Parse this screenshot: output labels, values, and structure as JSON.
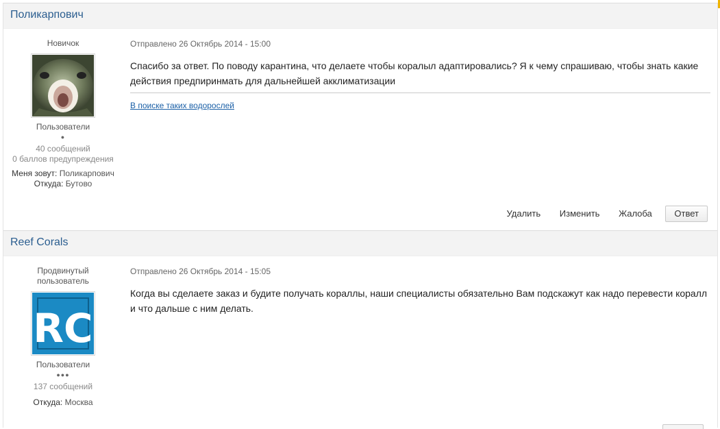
{
  "accent_color": "#2a5d8f",
  "posts": [
    {
      "author_name": "Поликарпович",
      "rank": "Новичок",
      "avatar": "fish-mouth-photo",
      "group": "Пользователи",
      "pips": "●",
      "posts_count": "40 сообщений",
      "warnings": "0 баллов предупреждения",
      "field1_key": "Меня зовут:",
      "field1_val": "Поликарпович",
      "field2_key": "Откуда:",
      "field2_val": "Бутово",
      "meta": "Отправлено 26 Октябрь 2014 - 15:00",
      "text": "Спасибо за ответ. По поводу карантина, что делаете чтобы коралыл адаптировались? Я к чему спрашиваю, чтобы знать какие действия предпиринмать для дальнейшей акклиматизации",
      "signature_link": "В поиске таких водорослей",
      "actions": {
        "delete": "Удалить",
        "edit": "Изменить",
        "report": "Жалоба",
        "reply": "Ответ"
      }
    },
    {
      "author_name": "Reef Corals",
      "rank": "Продвинутый пользователь",
      "avatar": "rc-logo",
      "avatar_text": "RC",
      "group": "Пользователи",
      "pips": "●●●",
      "posts_count": "137 сообщений",
      "field2_key": "Откуда:",
      "field2_val": "Москва",
      "meta": "Отправлено 26 Октябрь 2014 - 15:05",
      "text": "Когда вы сделаете заказ и будите получать кораллы, наши специалисты обязательно Вам подскажут как надо перевести коралл и что дальше с ним делать."
    }
  ]
}
